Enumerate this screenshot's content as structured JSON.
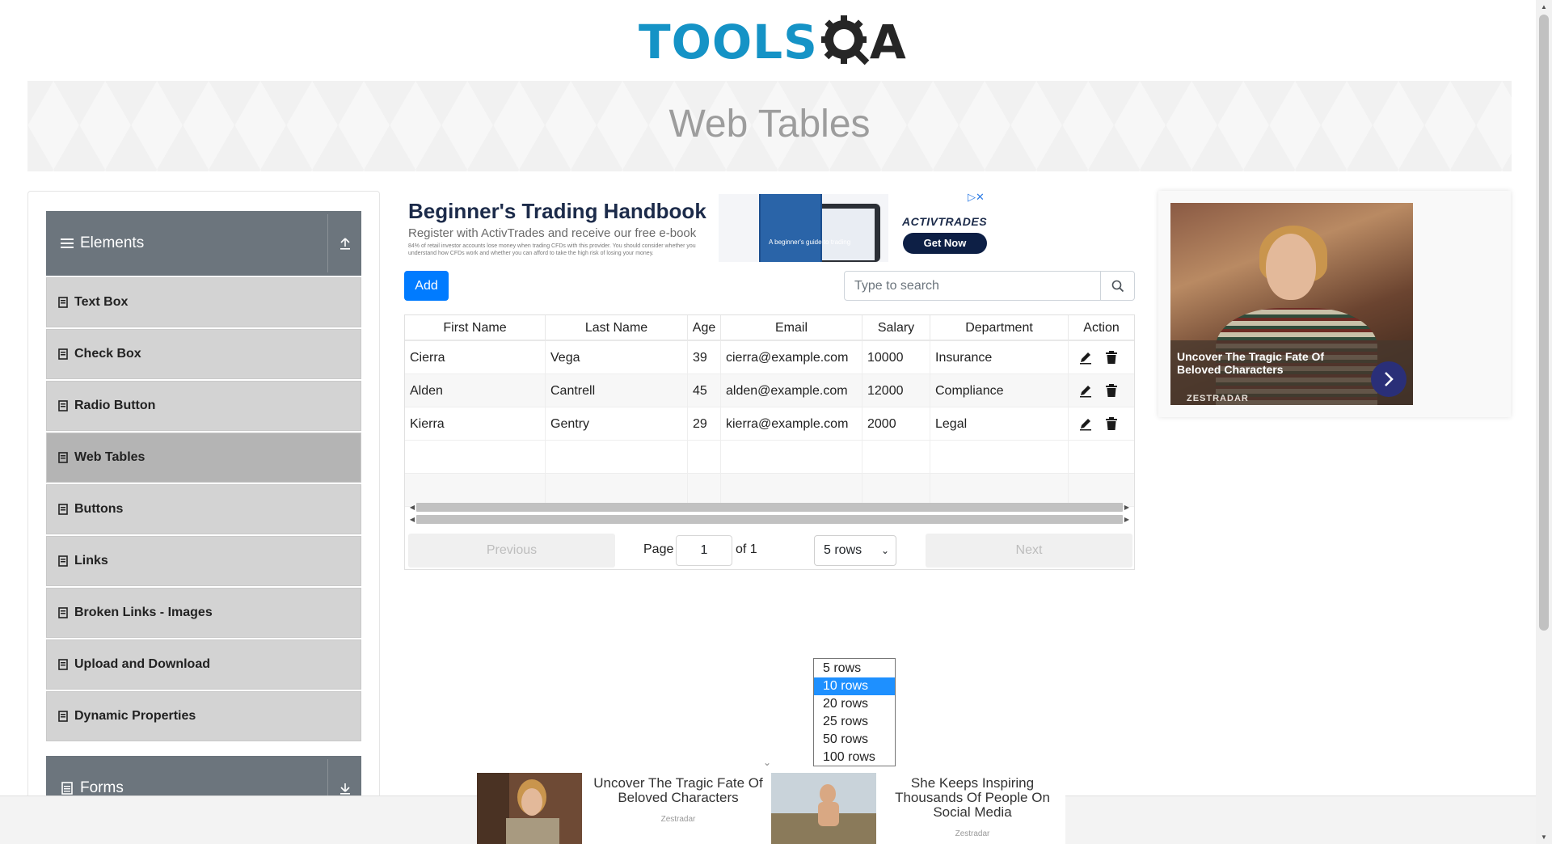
{
  "header": {
    "logo_text": "TOOLS",
    "logo_suffix": "A",
    "page_title": "Web Tables"
  },
  "sidebar": {
    "group_title": "Elements",
    "items": [
      {
        "label": "Text Box"
      },
      {
        "label": "Check Box"
      },
      {
        "label": "Radio Button"
      },
      {
        "label": "Web Tables"
      },
      {
        "label": "Buttons"
      },
      {
        "label": "Links"
      },
      {
        "label": "Broken Links - Images"
      },
      {
        "label": "Upload and Download"
      },
      {
        "label": "Dynamic Properties"
      }
    ],
    "active_item": "Web Tables",
    "next_group_title": "Forms"
  },
  "trade_ad": {
    "title": "Beginner's Trading Handbook",
    "subtitle": "Register with ActivTrades and receive our free e-book",
    "fine_print": "84% of retail investor accounts lose money when trading CFDs with this provider. You should consider whether you understand how CFDs work and whether you can afford to take the high risk of losing your money.",
    "book_text": "A beginner's guide to trading",
    "brand": "ACTIVTRADES",
    "cta": "Get Now"
  },
  "toolbar": {
    "add_label": "Add",
    "search_placeholder": "Type to search"
  },
  "table": {
    "columns": [
      "First Name",
      "Last Name",
      "Age",
      "Email",
      "Salary",
      "Department",
      "Action"
    ],
    "rows": [
      [
        "Cierra",
        "Vega",
        "39",
        "cierra@example.com",
        "10000",
        "Insurance"
      ],
      [
        "Alden",
        "Cantrell",
        "45",
        "alden@example.com",
        "12000",
        "Compliance"
      ],
      [
        "Kierra",
        "Gentry",
        "29",
        "kierra@example.com",
        "2000",
        "Legal"
      ]
    ]
  },
  "pagination": {
    "previous": "Previous",
    "page_label": "Page",
    "page_value": "1",
    "of_label": "of 1",
    "rows_selected": "5 rows",
    "next": "Next",
    "options": [
      "5 rows",
      "10 rows",
      "20 rows",
      "25 rows",
      "50 rows",
      "100 rows"
    ],
    "highlighted_option": "10 rows"
  },
  "right_ad": {
    "caption": "Uncover The Tragic Fate Of Beloved Characters",
    "brand": "ZESTRADAR"
  },
  "bottom_ads": [
    {
      "title": "Uncover The Tragic Fate Of Beloved Characters",
      "brand": "Zestradar"
    },
    {
      "title": "She Keeps Inspiring Thousands Of People On Social Media",
      "brand": "Zestradar"
    }
  ],
  "colors": {
    "accent": "#007bff",
    "logo_blue": "#1593c6",
    "sidebar_header": "#6c757d",
    "sidebar_item": "#d3d3d3"
  }
}
